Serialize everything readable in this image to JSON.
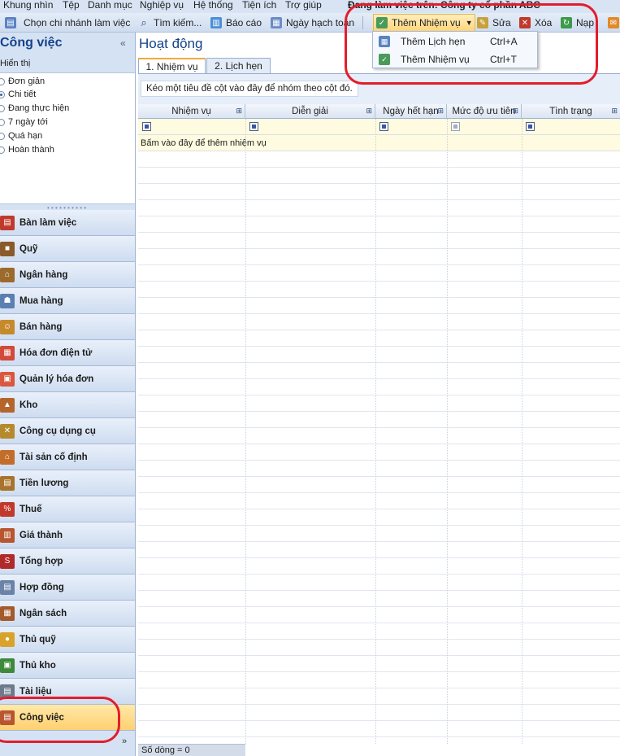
{
  "menubar": {
    "items": [
      "Khung nhìn",
      "Tệp",
      "Danh mục",
      "Nghiệp vụ",
      "Hệ thống",
      "Tiện ích",
      "Trợ giúp"
    ],
    "working_on": "Đang làm việc trên: Công ty cổ phần ABC"
  },
  "toolbar": {
    "branch": "Chọn chi nhánh làm việc",
    "search": "Tìm kiếm...",
    "report": "Báo cáo",
    "posting_date": "Ngày hạch toán",
    "add_task": "Thêm Nhiệm vụ",
    "edit": "Sửa",
    "delete": "Xóa",
    "load": "Nạp"
  },
  "dropdown": {
    "items": [
      {
        "label": "Thêm Lịch hẹn",
        "shortcut": "Ctrl+A"
      },
      {
        "label": "Thêm Nhiệm vụ",
        "shortcut": "Ctrl+T"
      }
    ]
  },
  "left": {
    "title": "Công việc",
    "collapse": "«",
    "view_label": "Hiển thị",
    "views": [
      {
        "label": "Đơn giản",
        "selected": false
      },
      {
        "label": "Chi tiết",
        "selected": true
      },
      {
        "label": "Đang thực hiện",
        "selected": false
      },
      {
        "label": "7 ngày tới",
        "selected": false
      },
      {
        "label": "Quá hạn",
        "selected": false
      },
      {
        "label": "Hoàn thành",
        "selected": false
      }
    ],
    "nav": [
      {
        "label": "Bàn làm việc",
        "icon": "desk-icon",
        "color": "#c0392b",
        "glyph": "▤"
      },
      {
        "label": "Quỹ",
        "icon": "safe-icon",
        "color": "#8a5a2b",
        "glyph": "■"
      },
      {
        "label": "Ngân hàng",
        "icon": "bank-icon",
        "color": "#9b6a2c",
        "glyph": "⌂"
      },
      {
        "label": "Mua hàng",
        "icon": "purchase-icon",
        "color": "#5b7fb0",
        "glyph": "☗"
      },
      {
        "label": "Bán hàng",
        "icon": "sales-icon",
        "color": "#c68a2d",
        "glyph": "☺"
      },
      {
        "label": "Hóa đơn điện tử",
        "icon": "e-invoice-icon",
        "color": "#d24a3a",
        "glyph": "▦"
      },
      {
        "label": "Quản lý hóa đơn",
        "icon": "invoice-management-icon",
        "color": "#d9573f",
        "glyph": "▣"
      },
      {
        "label": "Kho",
        "icon": "warehouse-icon",
        "color": "#b5652a",
        "glyph": "▲"
      },
      {
        "label": "Công cụ dụng cụ",
        "icon": "tools-icon",
        "color": "#b58a2d",
        "glyph": "✕"
      },
      {
        "label": "Tài sản cố định",
        "icon": "fixed-assets-icon",
        "color": "#c36d2b",
        "glyph": "⌂"
      },
      {
        "label": "Tiền lương",
        "icon": "salary-icon",
        "color": "#a8742b",
        "glyph": "▤"
      },
      {
        "label": "Thuế",
        "icon": "tax-icon",
        "color": "#c0392b",
        "glyph": "%"
      },
      {
        "label": "Giá thành",
        "icon": "cost-price-icon",
        "color": "#b8562f",
        "glyph": "▥"
      },
      {
        "label": "Tổng hợp",
        "icon": "general-ledger-icon",
        "color": "#b02a2a",
        "glyph": "S"
      },
      {
        "label": "Hợp đồng",
        "icon": "contract-icon",
        "color": "#6b83a8",
        "glyph": "▤"
      },
      {
        "label": "Ngân sách",
        "icon": "budget-icon",
        "color": "#a35b2b",
        "glyph": "▦"
      },
      {
        "label": "Thủ quỹ",
        "icon": "cashier-icon",
        "color": "#d9a32b",
        "glyph": "●"
      },
      {
        "label": "Thủ kho",
        "icon": "storekeeper-icon",
        "color": "#3d8a3a",
        "glyph": "▣"
      },
      {
        "label": "Tài liệu",
        "icon": "documents-icon",
        "color": "#6d7a8c",
        "glyph": "▤"
      },
      {
        "label": "Công việc",
        "icon": "tasks-icon",
        "color": "#b8562f",
        "glyph": "▤"
      }
    ],
    "more": "»"
  },
  "main": {
    "title": "Hoạt động",
    "tabs": [
      {
        "label": "1. Nhiệm vụ"
      },
      {
        "label": "2. Lịch hẹn"
      }
    ],
    "group_hint": "Kéo một tiêu đề cột vào đây để nhóm theo cột đó.",
    "columns": [
      "Nhiệm vụ",
      "Diễn giải",
      "Ngày hết hạn",
      "Mức độ ưu tiên",
      "Tình trạng"
    ],
    "add_row_hint": "Bấm vào đây để thêm nhiệm vụ",
    "status": "Số dòng = 0"
  },
  "colors": {
    "annotation_red": "#e31d2b",
    "active_accent": "#ffd071",
    "title_blue": "#15428b"
  }
}
